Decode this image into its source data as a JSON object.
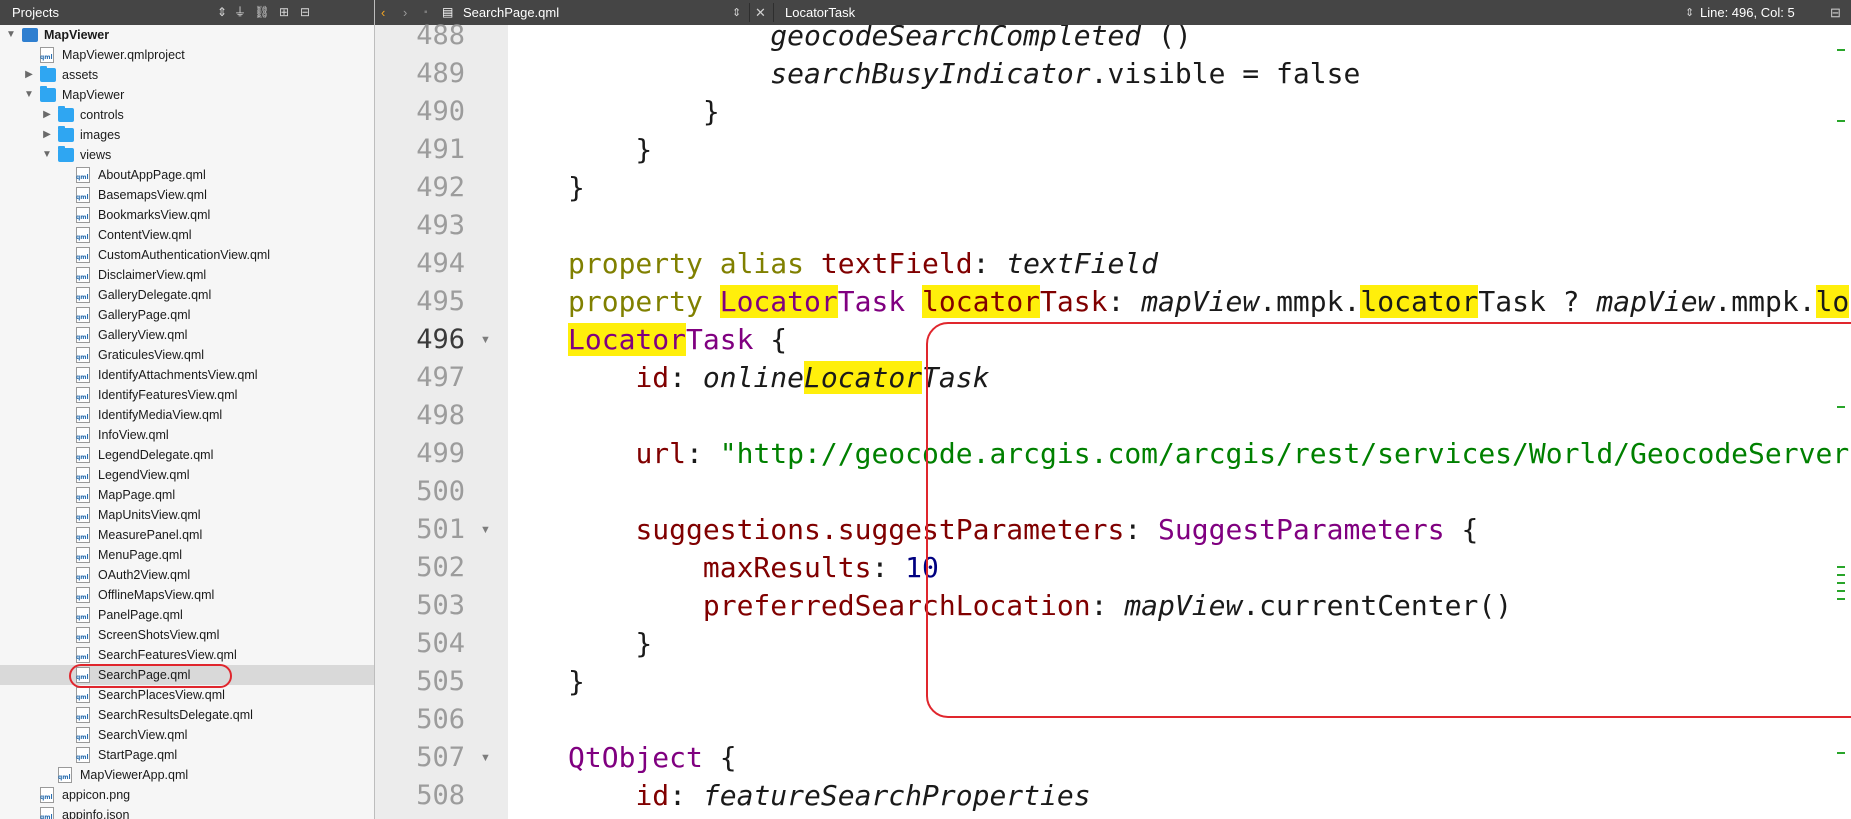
{
  "projects_pane": {
    "title": "Projects",
    "tree": [
      {
        "label": "MapViewer",
        "icon": "project",
        "level": 0,
        "arrow": "down",
        "bold": true
      },
      {
        "label": "MapViewer.qmlproject",
        "icon": "file",
        "level": 1,
        "arrow": ""
      },
      {
        "label": "assets",
        "icon": "folder",
        "level": 1,
        "arrow": "right"
      },
      {
        "label": "MapViewer",
        "icon": "folder",
        "level": 1,
        "arrow": "down"
      },
      {
        "label": "controls",
        "icon": "folder",
        "level": 2,
        "arrow": "right"
      },
      {
        "label": "images",
        "icon": "folder",
        "level": 2,
        "arrow": "right"
      },
      {
        "label": "views",
        "icon": "folder",
        "level": 2,
        "arrow": "down"
      },
      {
        "label": "AboutAppPage.qml",
        "icon": "file",
        "level": 3,
        "arrow": ""
      },
      {
        "label": "BasemapsView.qml",
        "icon": "file",
        "level": 3,
        "arrow": ""
      },
      {
        "label": "BookmarksView.qml",
        "icon": "file",
        "level": 3,
        "arrow": ""
      },
      {
        "label": "ContentView.qml",
        "icon": "file",
        "level": 3,
        "arrow": ""
      },
      {
        "label": "CustomAuthenticationView.qml",
        "icon": "file",
        "level": 3,
        "arrow": ""
      },
      {
        "label": "DisclaimerView.qml",
        "icon": "file",
        "level": 3,
        "arrow": ""
      },
      {
        "label": "GalleryDelegate.qml",
        "icon": "file",
        "level": 3,
        "arrow": ""
      },
      {
        "label": "GalleryPage.qml",
        "icon": "file",
        "level": 3,
        "arrow": ""
      },
      {
        "label": "GalleryView.qml",
        "icon": "file",
        "level": 3,
        "arrow": ""
      },
      {
        "label": "GraticulesView.qml",
        "icon": "file",
        "level": 3,
        "arrow": ""
      },
      {
        "label": "IdentifyAttachmentsView.qml",
        "icon": "file",
        "level": 3,
        "arrow": ""
      },
      {
        "label": "IdentifyFeaturesView.qml",
        "icon": "file",
        "level": 3,
        "arrow": ""
      },
      {
        "label": "IdentifyMediaView.qml",
        "icon": "file",
        "level": 3,
        "arrow": ""
      },
      {
        "label": "InfoView.qml",
        "icon": "file",
        "level": 3,
        "arrow": ""
      },
      {
        "label": "LegendDelegate.qml",
        "icon": "file",
        "level": 3,
        "arrow": ""
      },
      {
        "label": "LegendView.qml",
        "icon": "file",
        "level": 3,
        "arrow": ""
      },
      {
        "label": "MapPage.qml",
        "icon": "file",
        "level": 3,
        "arrow": ""
      },
      {
        "label": "MapUnitsView.qml",
        "icon": "file",
        "level": 3,
        "arrow": ""
      },
      {
        "label": "MeasurePanel.qml",
        "icon": "file",
        "level": 3,
        "arrow": ""
      },
      {
        "label": "MenuPage.qml",
        "icon": "file",
        "level": 3,
        "arrow": ""
      },
      {
        "label": "OAuth2View.qml",
        "icon": "file",
        "level": 3,
        "arrow": ""
      },
      {
        "label": "OfflineMapsView.qml",
        "icon": "file",
        "level": 3,
        "arrow": ""
      },
      {
        "label": "PanelPage.qml",
        "icon": "file",
        "level": 3,
        "arrow": ""
      },
      {
        "label": "ScreenShotsView.qml",
        "icon": "file",
        "level": 3,
        "arrow": ""
      },
      {
        "label": "SearchFeaturesView.qml",
        "icon": "file",
        "level": 3,
        "arrow": ""
      },
      {
        "label": "SearchPage.qml",
        "icon": "file",
        "level": 3,
        "arrow": "",
        "selected": true
      },
      {
        "label": "SearchPlacesView.qml",
        "icon": "file",
        "level": 3,
        "arrow": ""
      },
      {
        "label": "SearchResultsDelegate.qml",
        "icon": "file",
        "level": 3,
        "arrow": ""
      },
      {
        "label": "SearchView.qml",
        "icon": "file",
        "level": 3,
        "arrow": ""
      },
      {
        "label": "StartPage.qml",
        "icon": "file",
        "level": 3,
        "arrow": ""
      },
      {
        "label": "MapViewerApp.qml",
        "icon": "file",
        "level": 2,
        "arrow": ""
      },
      {
        "label": "appicon.png",
        "icon": "file",
        "level": 1,
        "arrow": ""
      },
      {
        "label": "appinfo.json",
        "icon": "file",
        "level": 1,
        "arrow": ""
      }
    ]
  },
  "editor": {
    "file_tab": "SearchPage.qml",
    "symbol": "LocatorTask",
    "cursor": "Line: 496, Col: 5",
    "current_line": 496,
    "lines": [
      {
        "n": 488,
        "fold": false,
        "tokens": [
          [
            "            ",
            ""
          ],
          [
            "geocodeSearchCompleted",
            "it"
          ],
          [
            " ()",
            ""
          ]
        ]
      },
      {
        "n": 489,
        "fold": false,
        "tokens": [
          [
            "            ",
            ""
          ],
          [
            "searchBusyIndicator",
            "it"
          ],
          [
            ".visible = false",
            ""
          ]
        ]
      },
      {
        "n": 490,
        "fold": false,
        "tokens": [
          [
            "        }",
            ""
          ]
        ]
      },
      {
        "n": 491,
        "fold": false,
        "tokens": [
          [
            "    }",
            ""
          ]
        ]
      },
      {
        "n": 492,
        "fold": false,
        "tokens": [
          [
            "}",
            ""
          ]
        ]
      },
      {
        "n": 493,
        "fold": false,
        "tokens": []
      },
      {
        "n": 494,
        "fold": false,
        "tokens": [
          [
            "property ",
            "kw"
          ],
          [
            "alias ",
            "kw"
          ],
          [
            "textField",
            "prop"
          ],
          [
            ": ",
            ""
          ],
          [
            "textField",
            "it"
          ]
        ]
      },
      {
        "n": 495,
        "fold": false,
        "tokens": [
          [
            "property ",
            "kw"
          ],
          [
            "Locator",
            "type hl"
          ],
          [
            "Task ",
            "type"
          ],
          [
            "locator",
            "prop hl"
          ],
          [
            "Task",
            "prop"
          ],
          [
            ": ",
            ""
          ],
          [
            "mapView",
            "it"
          ],
          [
            ".mmpk.",
            ""
          ],
          [
            "locator",
            "hl"
          ],
          [
            "Task ? ",
            ""
          ],
          [
            "mapView",
            "it"
          ],
          [
            ".mmpk.",
            ""
          ],
          [
            "lo",
            "hl"
          ]
        ]
      },
      {
        "n": 496,
        "fold": true,
        "tokens": [
          [
            "Locator",
            "type hl"
          ],
          [
            "Task",
            "type"
          ],
          [
            " {",
            ""
          ]
        ]
      },
      {
        "n": 497,
        "fold": false,
        "tokens": [
          [
            "    ",
            ""
          ],
          [
            "id",
            "prop"
          ],
          [
            ": ",
            ""
          ],
          [
            "online",
            "it"
          ],
          [
            "Locator",
            "it hl"
          ],
          [
            "Task",
            "it"
          ]
        ]
      },
      {
        "n": 498,
        "fold": false,
        "tokens": []
      },
      {
        "n": 499,
        "fold": false,
        "tokens": [
          [
            "    ",
            ""
          ],
          [
            "url",
            "prop"
          ],
          [
            ": ",
            ""
          ],
          [
            "\"http://geocode.arcgis.com/arcgis/rest/services/World/GeocodeServer",
            "str"
          ]
        ]
      },
      {
        "n": 500,
        "fold": false,
        "tokens": []
      },
      {
        "n": 501,
        "fold": true,
        "tokens": [
          [
            "    ",
            ""
          ],
          [
            "suggestions.suggestParameters",
            "prop"
          ],
          [
            ": ",
            ""
          ],
          [
            "SuggestParameters",
            "type"
          ],
          [
            " {",
            ""
          ]
        ]
      },
      {
        "n": 502,
        "fold": false,
        "tokens": [
          [
            "        ",
            ""
          ],
          [
            "maxResults",
            "prop"
          ],
          [
            ": ",
            ""
          ],
          [
            "10",
            "num"
          ]
        ]
      },
      {
        "n": 503,
        "fold": false,
        "tokens": [
          [
            "        ",
            ""
          ],
          [
            "preferredSearchLocation",
            "prop"
          ],
          [
            ": ",
            ""
          ],
          [
            "mapView",
            "it"
          ],
          [
            ".currentCenter()",
            ""
          ]
        ]
      },
      {
        "n": 504,
        "fold": false,
        "tokens": [
          [
            "    }",
            ""
          ]
        ]
      },
      {
        "n": 505,
        "fold": false,
        "tokens": [
          [
            "}",
            ""
          ]
        ]
      },
      {
        "n": 506,
        "fold": false,
        "tokens": []
      },
      {
        "n": 507,
        "fold": true,
        "tokens": [
          [
            "QtObject",
            "type"
          ],
          [
            " {",
            ""
          ]
        ]
      },
      {
        "n": 508,
        "fold": false,
        "tokens": [
          [
            "    ",
            ""
          ],
          [
            "id",
            "prop"
          ],
          [
            ": ",
            ""
          ],
          [
            "featureSearchProperties",
            "it"
          ]
        ]
      }
    ]
  },
  "icons": {
    "toolbar": [
      "up-down-icon",
      "filter-icon",
      "link-icon",
      "split-icon",
      "close-pane-icon"
    ],
    "editor_toolbar": [
      "back-icon",
      "forward-icon",
      "lock-icon",
      "file-icon",
      "up-down-icon",
      "close-icon",
      "up-down-icon",
      "split-icon"
    ]
  },
  "colors": {
    "toolbar_bg": "#454545",
    "highlight": "#ffef0b",
    "annotation": "#e0262d",
    "keyword": "#808000",
    "type": "#800080",
    "property": "#800000",
    "string": "#008000"
  }
}
